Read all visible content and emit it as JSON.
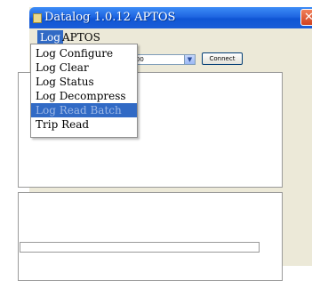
{
  "window": {
    "title": "Datalog 1.0.12 APTOS",
    "close_glyph": "✕"
  },
  "menubar": {
    "items": [
      {
        "label": "Log"
      },
      {
        "label": "APTOS"
      }
    ]
  },
  "log_menu": {
    "items": [
      {
        "label": "Log Configure"
      },
      {
        "label": "Log Clear"
      },
      {
        "label": "Log Status"
      },
      {
        "label": "Log Decompress"
      },
      {
        "label": "Log Read Batch"
      },
      {
        "label": "Trip Read"
      }
    ],
    "highlighted_index": 4
  },
  "connection": {
    "baud_label_partial": "te",
    "baud_value": "9600",
    "connect_label": "Connect"
  },
  "colors": {
    "titlebar": "#1f66e2",
    "menu_highlight": "#316ac5",
    "window_bg": "#ece9d8"
  },
  "icons": {
    "app": "app-icon",
    "close": "close-icon",
    "dropdown_arrow": "chevron-down-icon"
  }
}
